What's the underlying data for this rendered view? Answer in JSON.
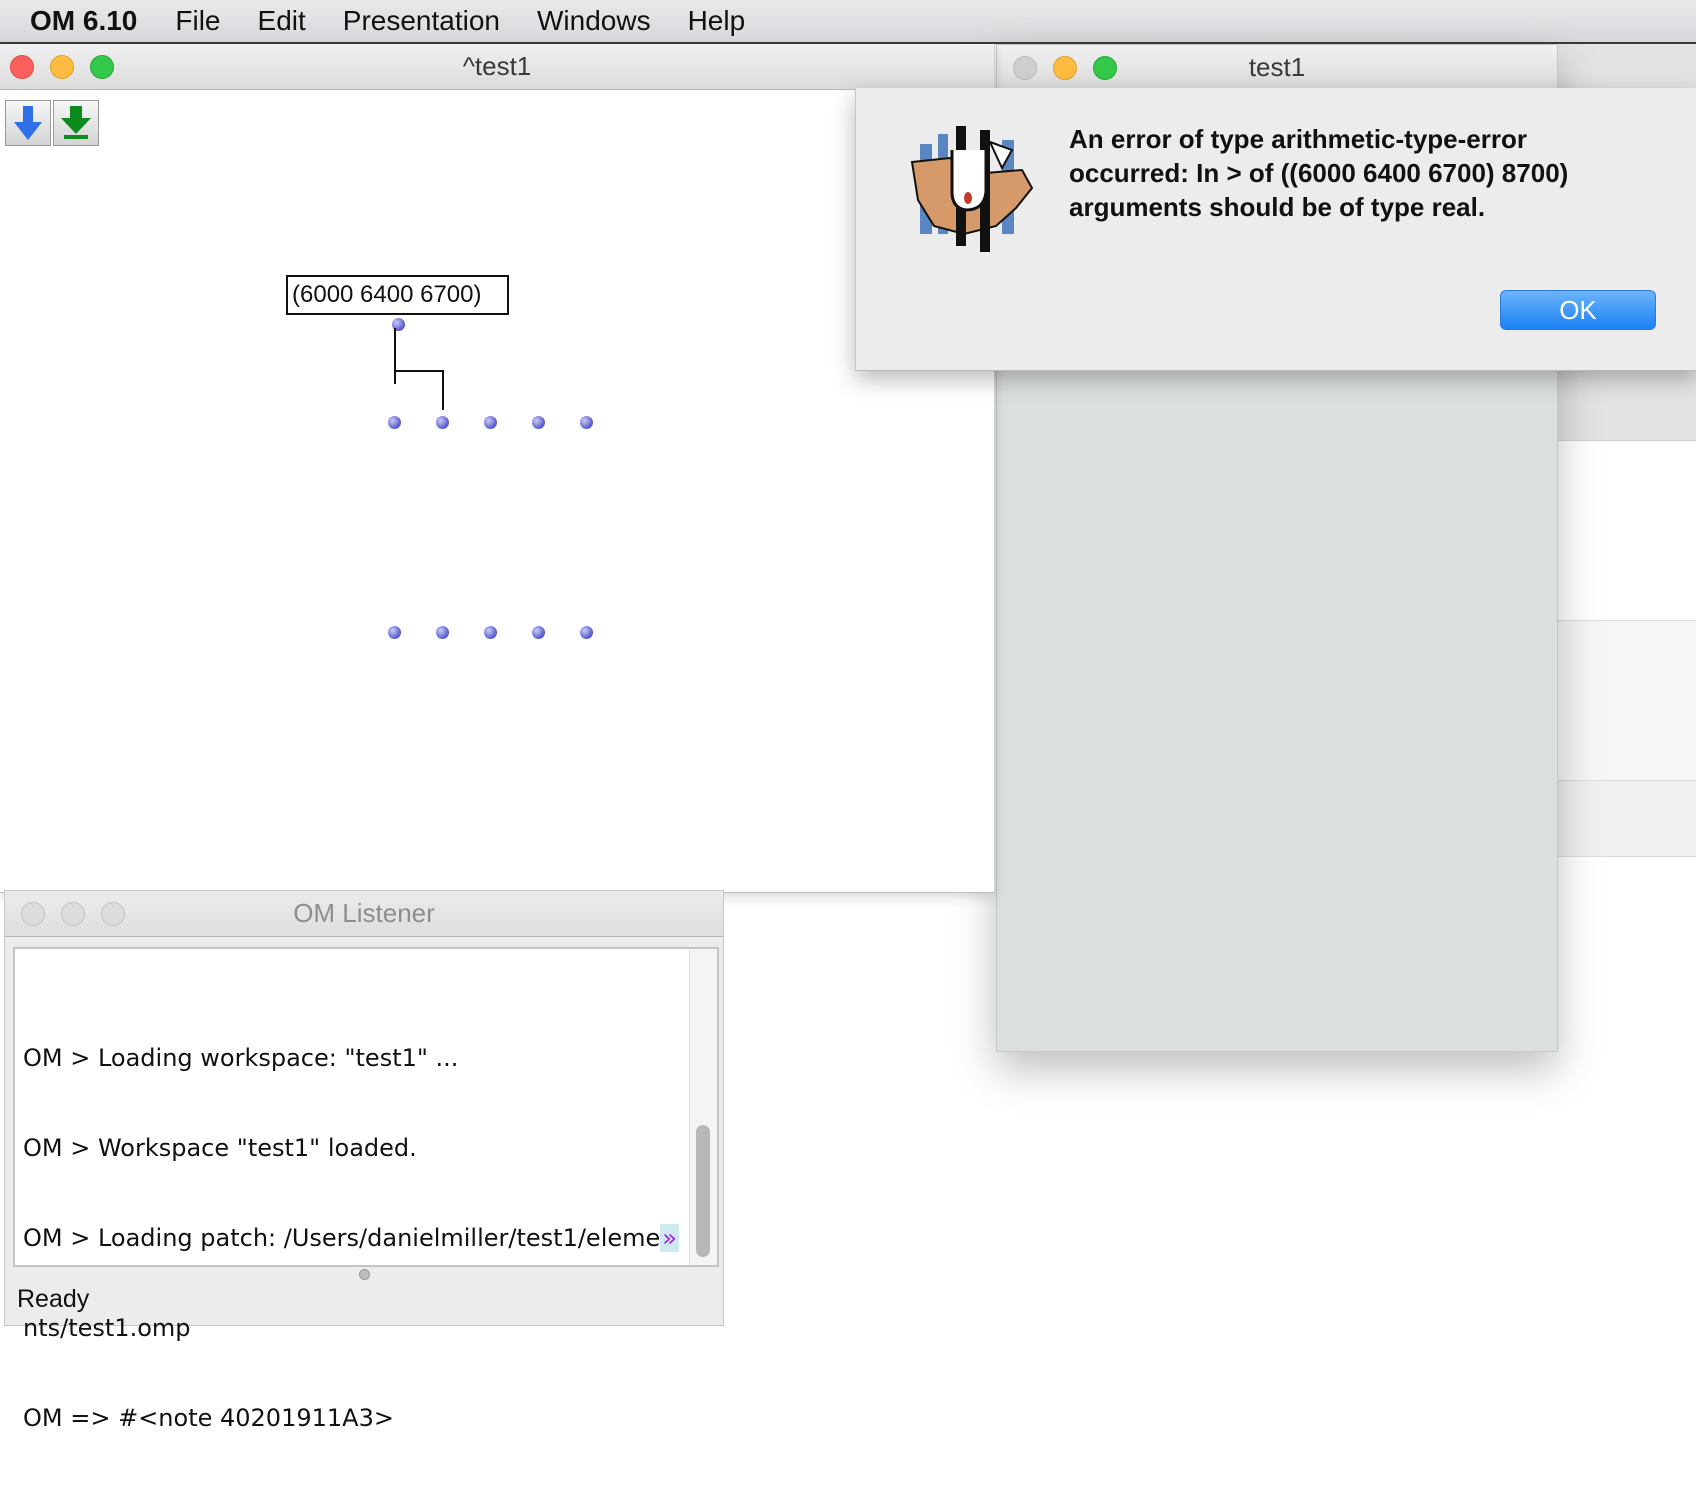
{
  "menubar": {
    "app_name": "OM 6.10",
    "items": [
      "File",
      "Edit",
      "Presentation",
      "Windows",
      "Help"
    ]
  },
  "patch_window": {
    "title": "^test1",
    "toolbar": {
      "blue_arrow_icon": "arrow-down-blue-icon",
      "green_arrow_icon": "arrow-down-green-icon"
    },
    "value_box": "(6000 6400 6700)"
  },
  "side_window": {
    "title": "test1"
  },
  "dialog": {
    "message_line1": "An error of type arithmetic-type-error",
    "message_line2": "occurred: In > of ((6000 6400 6700) 8700)",
    "message_line3": "arguments should be of type real.",
    "ok_label": "OK"
  },
  "listener": {
    "title": "OM Listener",
    "lines": [
      "OM > Loading workspace: \"test1\" ...",
      "OM > Workspace \"test1\" loaded.",
      "OM > Loading patch: /Users/danielmiller/test1/eleme",
      "nts/test1.omp",
      "OM => #<note 40201911A3>"
    ],
    "wrap_marker": "»",
    "status": "Ready"
  },
  "colors": {
    "accent_blue": "#1a82f5",
    "inlet_purple": "#5656c4"
  }
}
